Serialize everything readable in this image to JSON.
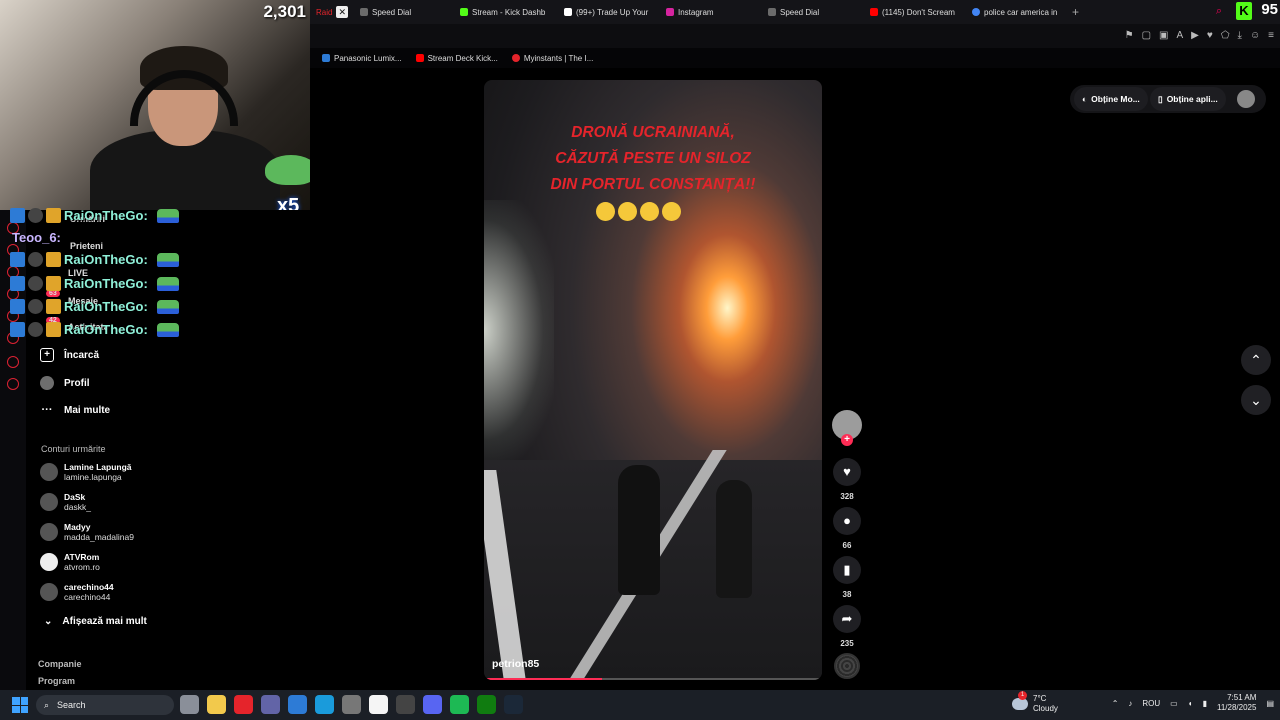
{
  "browser": {
    "tabs": [
      {
        "label": "Raid",
        "color": "#e5242b"
      },
      {
        "label": "Speed Dial",
        "color": "#6b6b6b"
      },
      {
        "label": "Stream - Kick Dashb",
        "color": "#53fc18"
      },
      {
        "label": "(99+) Trade Up Your",
        "color": "#ffffff"
      },
      {
        "label": "Instagram",
        "color": "#d6249f"
      },
      {
        "label": "Speed Dial",
        "color": "#6b6b6b"
      },
      {
        "label": "(1145) Don't Scream",
        "color": "#ff0000"
      },
      {
        "label": "police car america in",
        "color": "#4285f4"
      }
    ],
    "new_tab": "+",
    "kick_logo": "K",
    "kick_count": "95",
    "bookmarks": [
      {
        "label": "Panasonic Lumix...",
        "color": "#2d7bd6"
      },
      {
        "label": "Stream Deck Kick...",
        "color": "#ff0000"
      },
      {
        "label": "Myinstants | The I...",
        "color": "#e5242b"
      }
    ]
  },
  "stream": {
    "viewer_count": "2,301",
    "emote_multiplier": "x5",
    "chat": [
      {
        "user": "RaiOnTheGo:"
      },
      {
        "user": "RaiOnTheGo:"
      },
      {
        "user": "RaiOnTheGo:"
      },
      {
        "user": "RaiOnTheGo:"
      },
      {
        "user": "RaiOnTheGo:"
      },
      {
        "user": "RaiOnTheGo:"
      }
    ],
    "chat_teo": "Teoo_6:"
  },
  "sidebar": {
    "partial_items": [
      "Urmăriri",
      "Prieteni",
      "LIVE",
      "Mesaje",
      "Activitate"
    ],
    "badges": [
      "63",
      "42"
    ],
    "items": [
      {
        "label": "Încarcă",
        "icon": "upload-icon"
      },
      {
        "label": "Profil",
        "icon": "profile-icon"
      },
      {
        "label": "Mai multe",
        "icon": "more-icon"
      }
    ],
    "following_title": "Conturi urmărite",
    "accounts": [
      {
        "name": "Lamine Lapungă",
        "handle": "lamine.lapunga"
      },
      {
        "name": "DaSk",
        "handle": "daskk_"
      },
      {
        "name": "Madyy",
        "handle": "madda_madalina9"
      },
      {
        "name": "ATVRom",
        "handle": "atvrom.ro"
      },
      {
        "name": "carechino44",
        "handle": "carechino44"
      }
    ],
    "show_more": "Afișează mai mult",
    "footer": [
      "Companie",
      "Program"
    ]
  },
  "video": {
    "headline": [
      "DRONĂ UCRAINIANĂ,",
      "CĂZUTĂ PESTE UN SILOZ",
      "DIN PORTUL CONSTANȚA!!"
    ],
    "author": "petrion85",
    "progress": 0.35
  },
  "actions": {
    "likes": "328",
    "comments": "66",
    "saves": "38",
    "shares": "235"
  },
  "top_right": {
    "get_mode": "Obține Mo...",
    "get_app": "Obține apli..."
  },
  "taskbar": {
    "search": "Search",
    "temperature": "7°C",
    "condition": "Cloudy",
    "language": "ROU",
    "time": "7:51 AM",
    "date": "11/28/2025",
    "weather_badge": "1",
    "icons": [
      {
        "name": "task-view-icon",
        "color": "#8a8f99"
      },
      {
        "name": "file-explorer-icon",
        "color": "#f2c94c"
      },
      {
        "name": "opera-gx-icon",
        "color": "#e5242b"
      },
      {
        "name": "teams-icon",
        "color": "#6264a7"
      },
      {
        "name": "app-icon",
        "color": "#2d7bd6"
      },
      {
        "name": "edge-icon",
        "color": "#1a9bdb"
      },
      {
        "name": "settings-icon",
        "color": "#777"
      },
      {
        "name": "store-icon",
        "color": "#f5f5f5"
      },
      {
        "name": "obs-icon",
        "color": "#444"
      },
      {
        "name": "discord-icon",
        "color": "#5865f2"
      },
      {
        "name": "spotify-icon",
        "color": "#1db954"
      },
      {
        "name": "xbox-icon",
        "color": "#107c10"
      },
      {
        "name": "steam-icon",
        "color": "#1b2838"
      }
    ]
  }
}
